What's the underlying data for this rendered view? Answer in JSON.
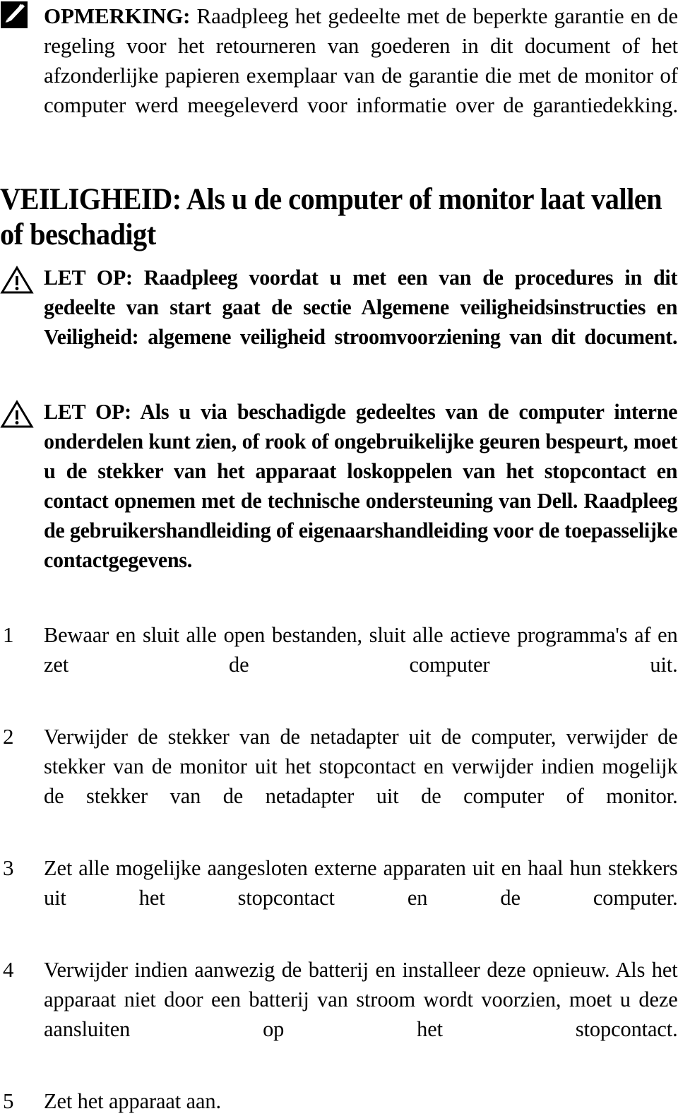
{
  "document": {
    "language": "nl",
    "note": {
      "icon": "dell-note-pen-icon",
      "lead_label": "OPMERKING:",
      "body": " Raadpleeg het gedeelte met de beperkte garantie en de regeling voor het retourneren van goederen in dit document of het afzonderlijke papieren exemplaar van de garantie die met de monitor of computer werd meegeleverd voor informatie over de garantiedekking."
    },
    "section_heading": "VEILIGHEID: Als u de computer of monitor laat vallen of beschadigt",
    "cautions": [
      {
        "icon": "warning-triangle-icon",
        "text": "LET OP: Raadpleeg voordat u met een van de procedures in dit gedeelte van start gaat de sectie Algemene veiligheidsinstructies en Veiligheid: algemene veiligheid stroomvoorziening van dit document."
      },
      {
        "icon": "warning-triangle-icon",
        "text": "LET OP: Als u via beschadigde gedeeltes van de computer interne onderdelen kunt zien, of rook of ongebruikelijke geuren bespeurt, moet u de stekker van het apparaat loskoppelen van het stopcontact en contact opnemen met de technische ondersteuning van Dell. Raadpleeg de gebruikershandleiding of eigenaarshandleiding voor de toepasselijke contactgegevens."
      }
    ],
    "steps": [
      {
        "number": "1",
        "text": "Bewaar en sluit alle open bestanden, sluit alle actieve programma's af en zet de computer uit."
      },
      {
        "number": "2",
        "text": "Verwijder de stekker van de netadapter uit de computer, verwijder de stekker van de monitor uit het stopcontact en verwijder indien mogelijk de stekker van de netadapter uit de computer of monitor."
      },
      {
        "number": "3",
        "text": "Zet alle mogelijke aangesloten externe apparaten uit en haal hun stekkers uit het stopcontact en de computer."
      },
      {
        "number": "4",
        "text": "Verwijder indien aanwezig de batterij en installeer deze opnieuw. Als het apparaat niet door een batterij van stroom wordt voorzien, moet u deze aansluiten op het stopcontact."
      },
      {
        "number": "5",
        "text": "Zet het apparaat aan."
      }
    ],
    "colors": {
      "text": "#000000",
      "background": "#ffffff"
    }
  }
}
